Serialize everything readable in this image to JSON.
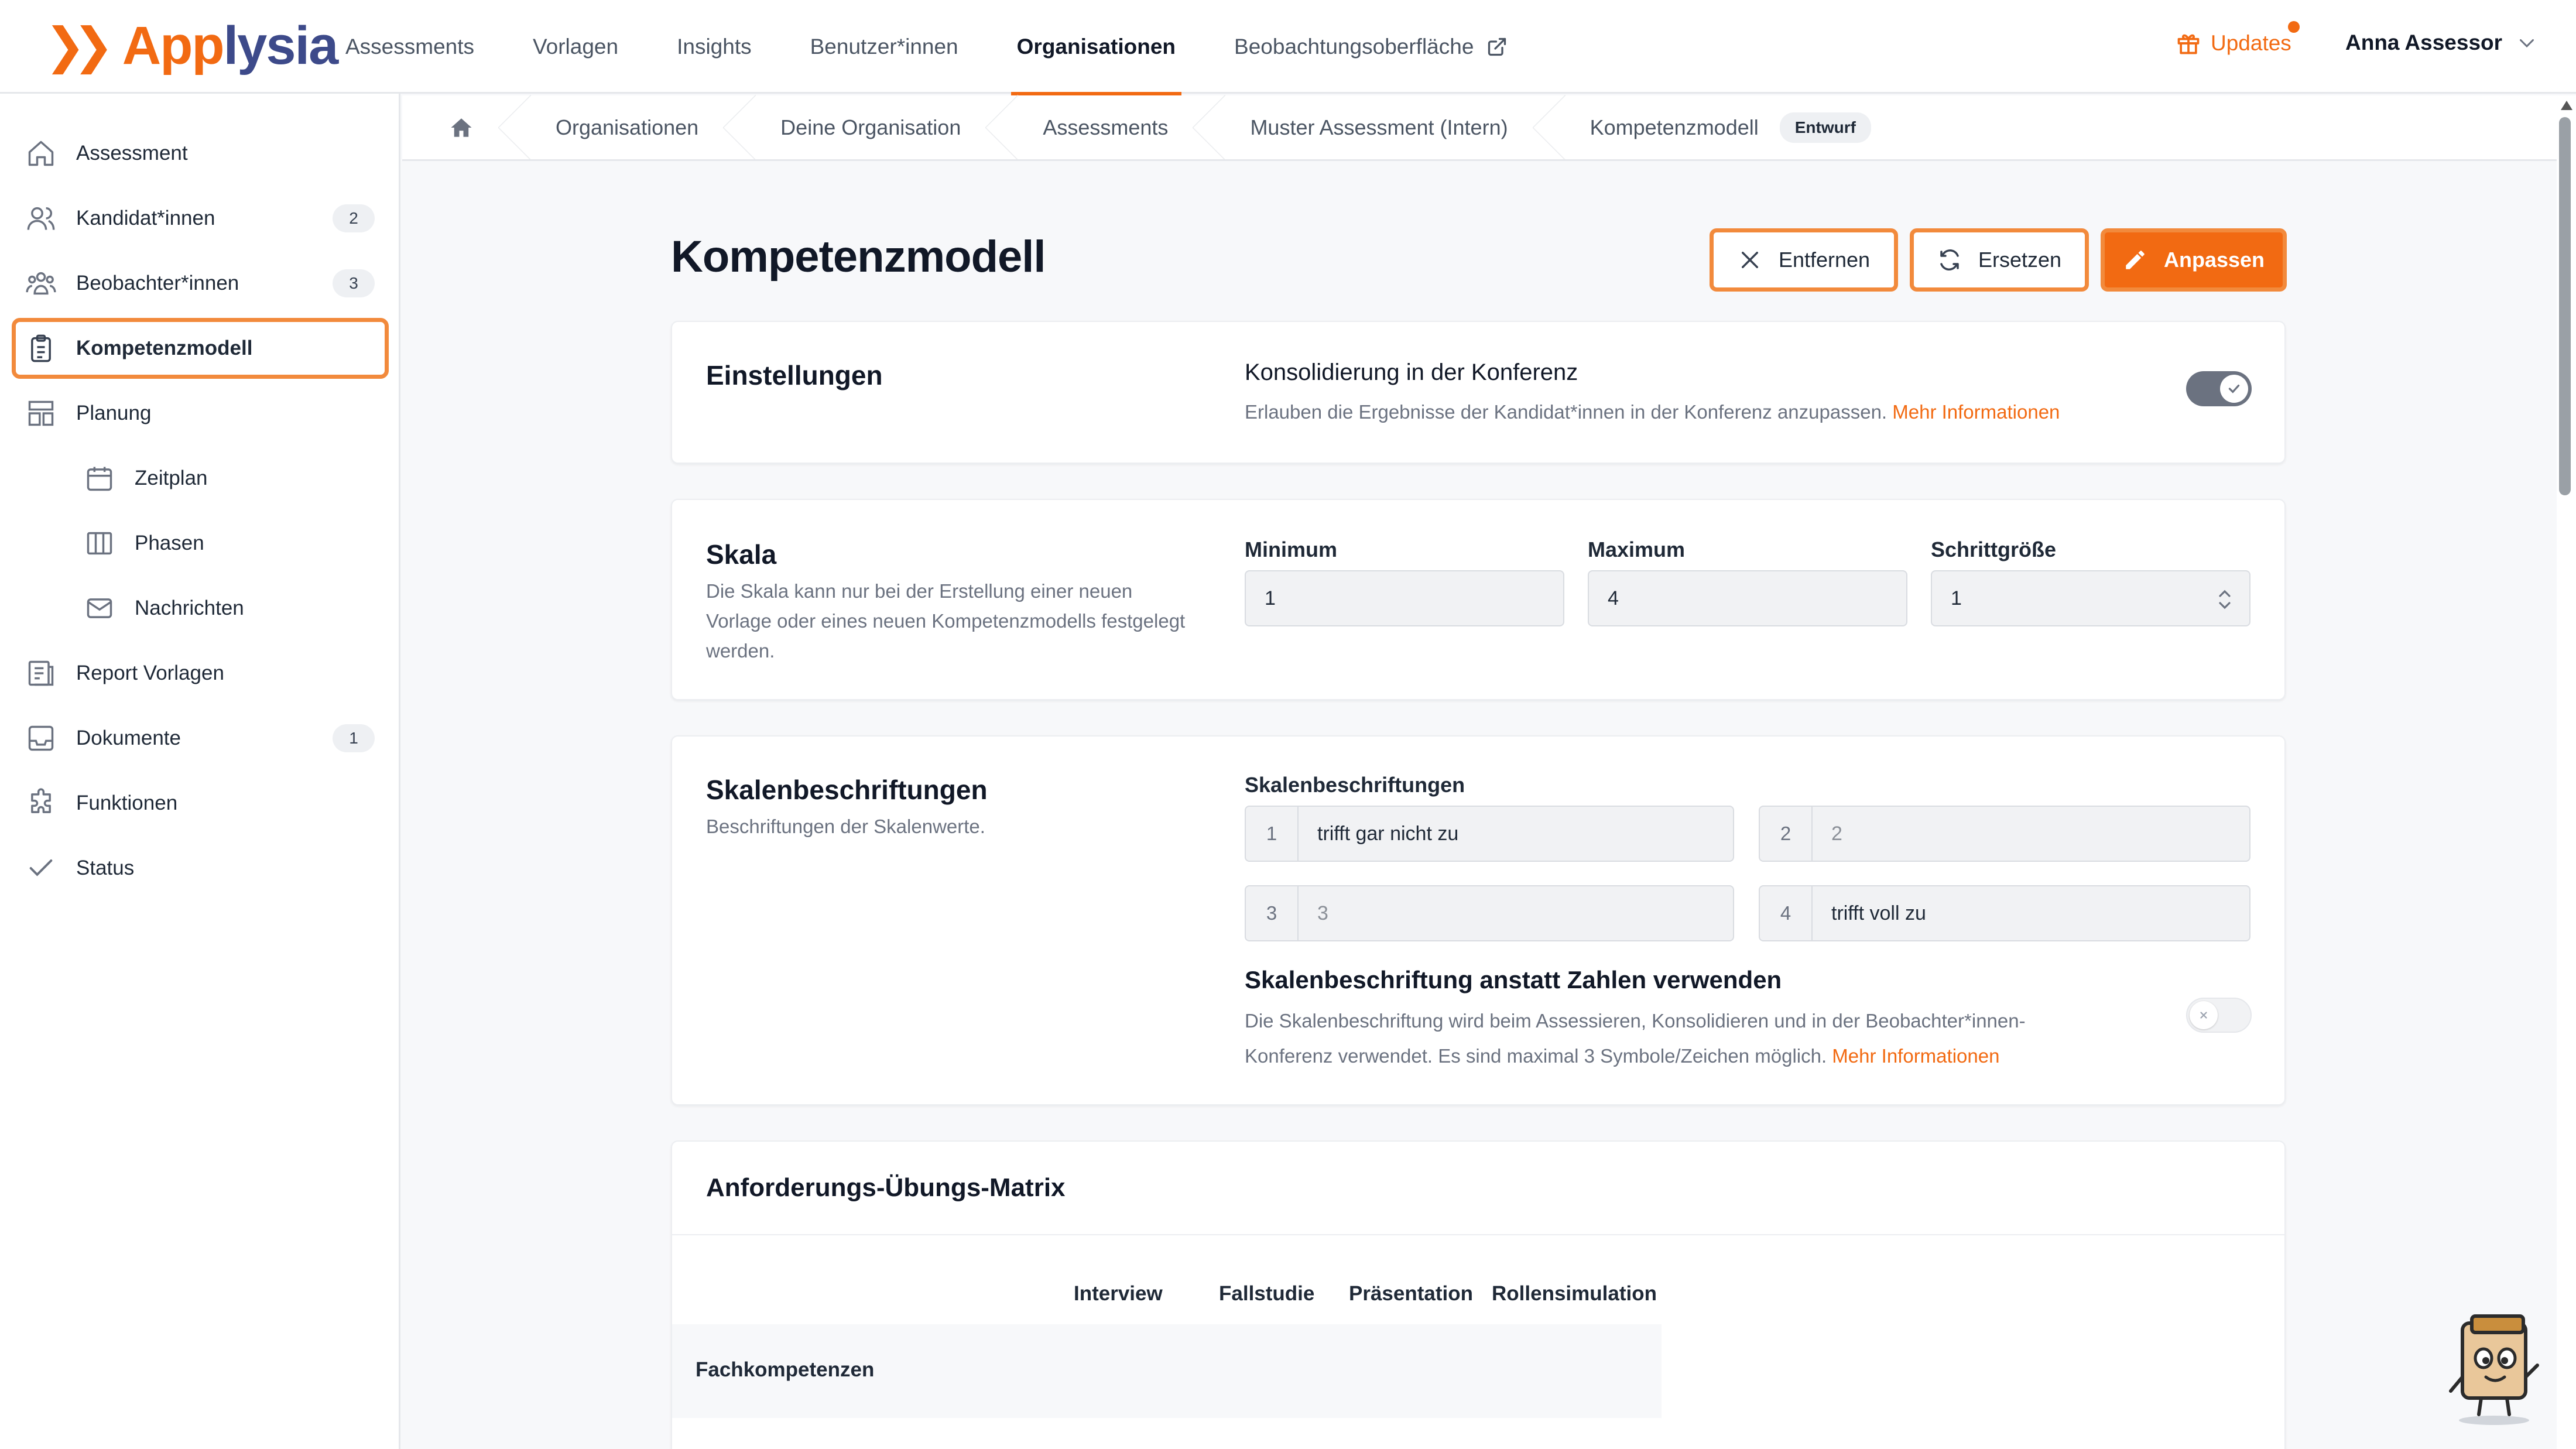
{
  "brand": {
    "logo_part1": "App",
    "logo_part2": "lysia",
    "accent": "#f26a12",
    "secondary": "#3d4a8a"
  },
  "nav": {
    "items": [
      "Assessments",
      "Vorlagen",
      "Insights",
      "Benutzer*innen",
      "Organisationen",
      "Beobachtungsoberfläche"
    ],
    "active": "Organisationen",
    "updates_label": "Updates",
    "user_name": "Anna Assessor"
  },
  "sidebar": {
    "items": [
      {
        "label": "Assessment",
        "icon": "home-icon"
      },
      {
        "label": "Kandidat*innen",
        "icon": "users-icon",
        "badge": "2"
      },
      {
        "label": "Beobachter*innen",
        "icon": "group-icon",
        "badge": "3"
      },
      {
        "label": "Kompetenzmodell",
        "icon": "clipboard-icon",
        "active": true
      },
      {
        "label": "Planung",
        "icon": "layout-icon"
      },
      {
        "label": "Zeitplan",
        "icon": "calendar-icon"
      },
      {
        "label": "Phasen",
        "icon": "columns-icon"
      },
      {
        "label": "Nachrichten",
        "icon": "mail-icon"
      },
      {
        "label": "Report Vorlagen",
        "icon": "report-icon"
      },
      {
        "label": "Dokumente",
        "icon": "inbox-icon",
        "badge": "1"
      },
      {
        "label": "Funktionen",
        "icon": "puzzle-icon"
      },
      {
        "label": "Status",
        "icon": "check-icon"
      }
    ]
  },
  "breadcrumb": {
    "items": [
      "Organisationen",
      "Deine Organisation",
      "Assessments",
      "Muster Assessment (Intern)",
      "Kompetenzmodell"
    ],
    "status_badge": "Entwurf"
  },
  "page": {
    "title": "Kompetenzmodell",
    "remove_label": "Entfernen",
    "replace_label": "Ersetzen",
    "adjust_label": "Anpassen"
  },
  "settings": {
    "title": "Einstellungen",
    "consolidation_title": "Konsolidierung in der Konferenz",
    "consolidation_desc": "Erlauben die Ergebnisse der Kandidat*innen in der Konferenz anzupassen.",
    "more_info": "Mehr Informationen",
    "consolidation_enabled": true
  },
  "scale": {
    "title": "Skala",
    "desc_line1": "Die Skala kann nur bei der Erstellung einer neuen",
    "desc_line2": "Vorlage oder eines neuen Kompetenzmodells festgelegt",
    "desc_line3": "werden.",
    "min_label": "Minimum",
    "min_value": "1",
    "max_label": "Maximum",
    "max_value": "4",
    "step_label": "Schrittgröße",
    "step_value": "1"
  },
  "scale_labels": {
    "title": "Skalenbeschriftungen",
    "desc": "Beschriftungen der Skalenwerte.",
    "field_label": "Skalenbeschriftungen",
    "entries": [
      {
        "num": "1",
        "value": "trifft gar nicht zu",
        "placeholder": false
      },
      {
        "num": "2",
        "value": "2",
        "placeholder": true
      },
      {
        "num": "3",
        "value": "3",
        "placeholder": true
      },
      {
        "num": "4",
        "value": "trifft voll zu",
        "placeholder": false
      }
    ],
    "use_labels_title": "Skalenbeschriftung anstatt Zahlen verwenden",
    "use_labels_desc_line1": "Die Skalenbeschriftung wird beim Assessieren, Konsolidieren und in der Beobachter*innen-",
    "use_labels_desc_line2": "Konferenz verwendet. Es sind maximal 3 Symbole/Zeichen möglich.",
    "more_info": "Mehr Informationen",
    "use_labels_enabled": false
  },
  "matrix": {
    "title": "Anforderungs-Übungs-Matrix",
    "columns": [
      "Interview",
      "Fallstudie",
      "Präsentation",
      "Rollensimulation"
    ],
    "group": "Fachkompetenzen"
  }
}
